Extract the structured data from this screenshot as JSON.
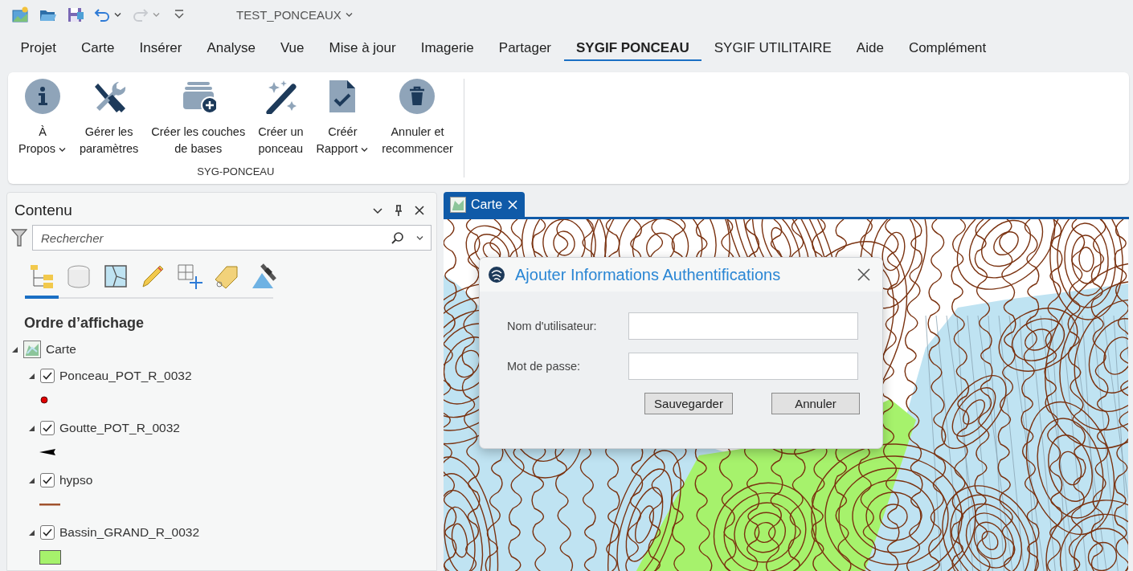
{
  "quick_access": {
    "icons": [
      {
        "kind": "new"
      },
      {
        "kind": "open"
      },
      {
        "kind": "save"
      },
      {
        "kind": "undo",
        "disabled": false
      },
      {
        "kind": "redo",
        "disabled": true
      },
      {
        "kind": "customize"
      }
    ],
    "title": "TEST_PONCEAUX"
  },
  "menu_tabs": [
    {
      "label": "Projet",
      "selected": false
    },
    {
      "label": "Carte",
      "selected": false
    },
    {
      "label": "Insérer",
      "selected": false
    },
    {
      "label": "Analyse",
      "selected": false
    },
    {
      "label": "Vue",
      "selected": false
    },
    {
      "label": "Mise à jour",
      "selected": false
    },
    {
      "label": "Imagerie",
      "selected": false
    },
    {
      "label": "Partager",
      "selected": false
    },
    {
      "label": "SYGIF PONCEAU",
      "selected": true
    },
    {
      "label": "SYGIF UTILITAIRE",
      "selected": false
    },
    {
      "label": "Aide",
      "selected": false
    },
    {
      "label": "Complément",
      "selected": false
    }
  ],
  "ribbon": {
    "buttons": [
      {
        "kind": "info",
        "lines": [
          "À",
          "Propos"
        ],
        "dropdown": true
      },
      {
        "kind": "tools",
        "lines": [
          "Gérer les",
          "paramètres"
        ],
        "dropdown": false
      },
      {
        "kind": "layers",
        "lines": [
          "Créer les couches",
          "de bases"
        ],
        "dropdown": false
      },
      {
        "kind": "wand",
        "lines": [
          "Créer un",
          "ponceau"
        ],
        "dropdown": false
      },
      {
        "kind": "report",
        "lines": [
          "Créér",
          "Rapport"
        ],
        "dropdown": true
      },
      {
        "kind": "trash",
        "lines": [
          "Annuler et",
          "recommencer"
        ],
        "dropdown": false
      }
    ],
    "group_label": "SYG-PONCEAU"
  },
  "contents": {
    "title": "Contenu",
    "search": {
      "placeholder": "Rechercher"
    },
    "views": [
      {
        "kind": "drawing-order",
        "selected": true
      },
      {
        "kind": "data-source",
        "selected": false
      },
      {
        "kind": "selection",
        "selected": false
      },
      {
        "kind": "editing",
        "selected": false
      },
      {
        "kind": "snapping",
        "selected": false
      },
      {
        "kind": "labeling",
        "selected": false
      },
      {
        "kind": "perspective",
        "selected": false
      }
    ],
    "heading": "Ordre d’affichage",
    "map": {
      "label": "Carte",
      "expanded": true,
      "children": [
        {
          "label": "Ponceau_POT_R_0032",
          "checked": true,
          "expanded": true,
          "symbol": {
            "kind": "point",
            "color": "#e00000"
          }
        },
        {
          "label": "Goutte_POT_R_0032",
          "checked": true,
          "expanded": true,
          "symbol": {
            "kind": "arrow",
            "color": "#000000"
          }
        },
        {
          "label": "hypso",
          "checked": true,
          "expanded": true,
          "symbol": {
            "kind": "line",
            "color": "#a0522d"
          }
        },
        {
          "label": "Bassin_GRAND_R_0032",
          "checked": true,
          "expanded": true,
          "symbol": {
            "kind": "fill",
            "color": "#a6f26c"
          }
        }
      ]
    }
  },
  "map_tab": {
    "label": "Carte",
    "selected": true
  },
  "dialog": {
    "title": "Ajouter Informations Authentifications",
    "fields": [
      {
        "label": "Nom d'utilisateur:"
      },
      {
        "label": "Mot de passe:"
      }
    ],
    "buttons": [
      "Sauvegarder",
      "Annuler"
    ]
  }
}
